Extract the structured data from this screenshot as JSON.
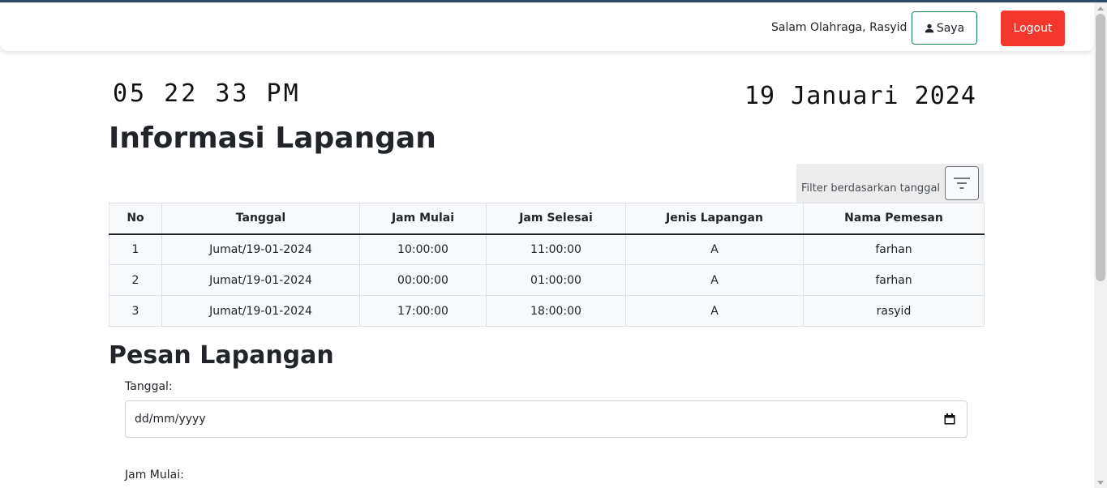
{
  "navbar": {
    "greeting": "Salam Olahraga, Rasyid",
    "profile_label": "Saya",
    "logout_label": "Logout"
  },
  "clock": {
    "time": "05 22 33 PM",
    "date": "19 Januari 2024"
  },
  "info_section": {
    "title": "Informasi Lapangan",
    "filter_label": "Filter berdasarkan tanggal",
    "table": {
      "headers": [
        "No",
        "Tanggal",
        "Jam Mulai",
        "Jam Selesai",
        "Jenis Lapangan",
        "Nama Pemesan"
      ],
      "rows": [
        [
          "1",
          "Jumat/19-01-2024",
          "10:00:00",
          "11:00:00",
          "A",
          "farhan"
        ],
        [
          "2",
          "Jumat/19-01-2024",
          "00:00:00",
          "01:00:00",
          "A",
          "farhan"
        ],
        [
          "3",
          "Jumat/19-01-2024",
          "17:00:00",
          "18:00:00",
          "A",
          "rasyid"
        ]
      ]
    }
  },
  "booking_section": {
    "title": "Pesan Lapangan",
    "date_label": "Tanggal:",
    "date_placeholder": "dd/mm/yyyy",
    "start_time_label": "Jam Mulai:"
  },
  "colors": {
    "logout": "#f4372c",
    "profile_border": "#198754",
    "top_accent": "#2c4a63"
  },
  "icons": {
    "profile": "user-icon",
    "filter": "filter-icon",
    "date_picker": "calendar-icon"
  }
}
